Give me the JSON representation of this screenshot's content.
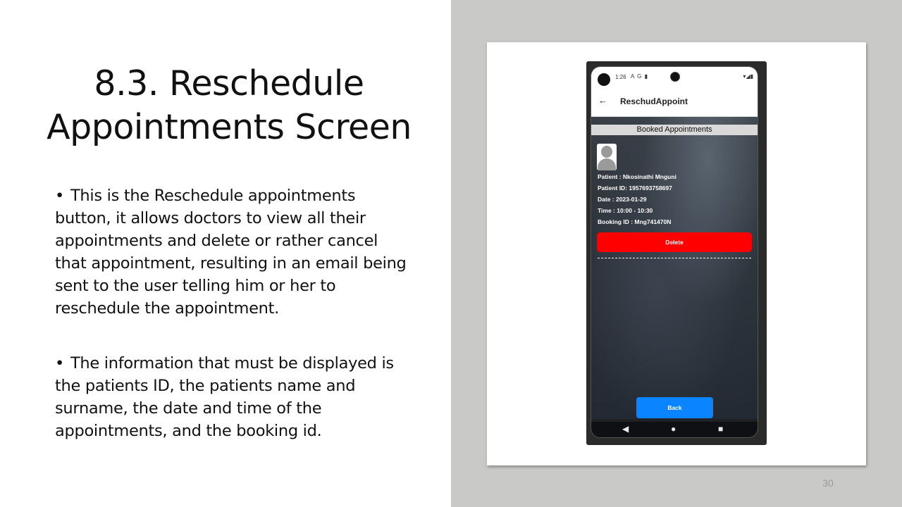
{
  "slide": {
    "title": "8.3. Reschedule Appointments Screen",
    "title_line1": "8.3. Reschedule",
    "title_line2": "Appointments Screen",
    "bullets": [
      "This is the Reschedule appointments button, it allows doctors to view all their appointments and delete or rather cancel that appointment, resulting in an email being sent to the user telling him or her to reschedule the appointment.",
      "The information that must be displayed is the patients ID, the patients name and surname,  the date and time of the appointments, and the booking id."
    ],
    "bullet_symbol": "•",
    "page_number": "30",
    "colors": {
      "right_panel_bg": "#c9cac8",
      "card_bg": "#ffffff"
    }
  },
  "phone": {
    "status_bar": {
      "time": "1:26",
      "left_icons": "A G ▮",
      "right_icons": "▾◢▮"
    },
    "app_bar": {
      "back_icon": "←",
      "title": "ReschudAppoint"
    },
    "section_header": "Booked Appointments",
    "appointment": {
      "patient": "Patient : Nkosinathi  Mnguni",
      "patient_id": "Patient ID: 1957693758697",
      "date": "Date : 2023-01-29",
      "time": "Time : 10:00 - 10:30",
      "booking_id": "Booking ID : Mng741470N"
    },
    "delete_label": "Delete",
    "back_label": "Back",
    "nav": {
      "back": "◀",
      "home": "●",
      "recents": "■"
    },
    "colors": {
      "delete": "#ff0000",
      "back": "#0a84ff"
    }
  }
}
